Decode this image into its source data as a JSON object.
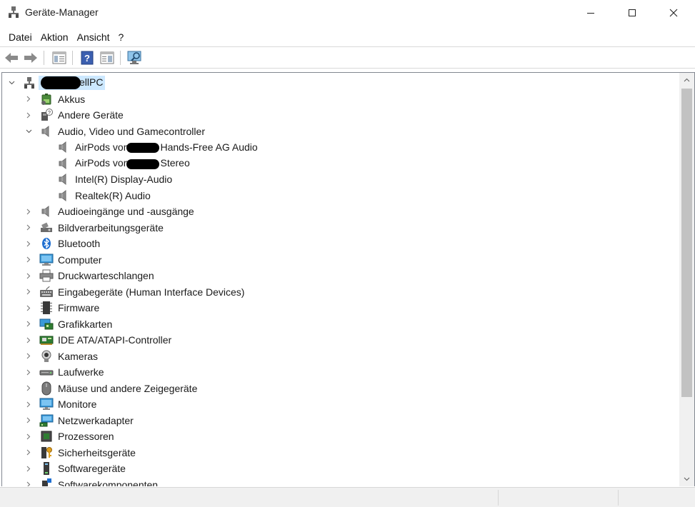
{
  "window": {
    "title": "Geräte-Manager",
    "icon": "device-manager-icon"
  },
  "menu": [
    "Datei",
    "Aktion",
    "Ansicht",
    "?"
  ],
  "toolbar": {
    "buttons": [
      "back-arrow-icon",
      "forward-arrow-icon",
      "properties-icon",
      "help-icon",
      "view-panel-icon",
      "monitor-scan-icon"
    ]
  },
  "tree": {
    "root": {
      "label": "ellPC",
      "expanded": true,
      "redacted_prefix": true
    },
    "audio_children": [
      {
        "label_pre": "AirPods von",
        "label_post": "Hands-Free AG Audio",
        "redacted": true
      },
      {
        "label_pre": "AirPods von",
        "label_post": "Stereo",
        "redacted": true
      },
      {
        "label": "Intel(R) Display-Audio"
      },
      {
        "label": "Realtek(R) Audio"
      }
    ],
    "categories": [
      {
        "label": "Akkus",
        "icon": "battery-icon"
      },
      {
        "label": "Andere Geräte",
        "icon": "unknown-device-icon"
      },
      {
        "label": "Audio, Video und Gamecontroller",
        "icon": "speaker-icon",
        "expanded": true
      },
      {
        "label": "Audioeingänge und -ausgänge",
        "icon": "speaker-icon"
      },
      {
        "label": "Bildverarbeitungsgeräte",
        "icon": "camera-scanner-icon"
      },
      {
        "label": "Bluetooth",
        "icon": "bluetooth-icon"
      },
      {
        "label": "Computer",
        "icon": "computer-icon"
      },
      {
        "label": "Druckwarteschlangen",
        "icon": "printer-icon"
      },
      {
        "label": "Eingabegeräte (Human Interface Devices)",
        "icon": "keyboard-icon"
      },
      {
        "label": "Firmware",
        "icon": "chip-icon"
      },
      {
        "label": "Grafikkarten",
        "icon": "display-adapter-icon"
      },
      {
        "label": "IDE ATA/ATAPI-Controller",
        "icon": "controller-icon"
      },
      {
        "label": "Kameras",
        "icon": "webcam-icon"
      },
      {
        "label": "Laufwerke",
        "icon": "disk-drive-icon"
      },
      {
        "label": "Mäuse und andere Zeigegeräte",
        "icon": "mouse-icon"
      },
      {
        "label": "Monitore",
        "icon": "monitor-icon"
      },
      {
        "label": "Netzwerkadapter",
        "icon": "network-adapter-icon"
      },
      {
        "label": "Prozessoren",
        "icon": "processor-icon"
      },
      {
        "label": "Sicherheitsgeräte",
        "icon": "security-key-icon"
      },
      {
        "label": "Softwaregeräte",
        "icon": "software-device-icon"
      },
      {
        "label": "Softwarekomponenten",
        "icon": "software-component-icon"
      }
    ]
  },
  "colors": {
    "selection": "#cce8ff",
    "scrollbar_thumb": "#c2c2c2",
    "statusbar": "#f0f0f0"
  }
}
